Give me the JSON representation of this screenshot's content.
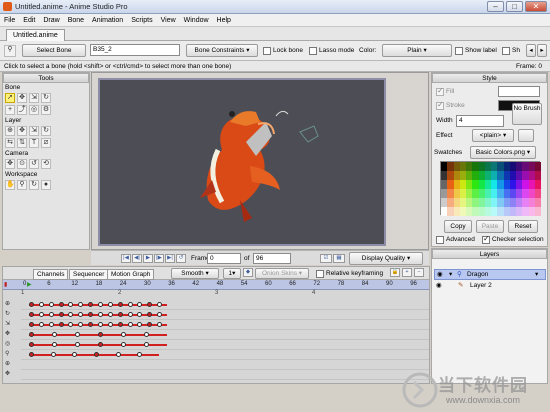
{
  "window": {
    "title": "Untitled.anime - Anime Studio Pro",
    "min": "–",
    "max": "□",
    "close": "✕"
  },
  "menu": [
    "File",
    "Edit",
    "Draw",
    "Bone",
    "Animation",
    "Scripts",
    "View",
    "Window",
    "Help"
  ],
  "doc_tab": "Untitled.anime",
  "tool_options": {
    "select_bone": "Select Bone",
    "bone_name": "B35_2",
    "bone_constraints": "Bone Constraints",
    "lock_bone": "Lock bone",
    "lasso_mode": "Lasso mode",
    "color_label": "Color:",
    "color_value": "Plain",
    "show_label": "Show label",
    "sh_trunc": "Sh"
  },
  "status": {
    "hint": "Click to select a bone (hold <shift> or <ctrl/cmd> to select more than one bone)",
    "frame": "Frame: 0"
  },
  "tools": {
    "title": "Tools",
    "groups": [
      "Bone",
      "Layer",
      "Camera",
      "Workspace"
    ]
  },
  "playback": {
    "frame_label": "Frame",
    "frame_value": "0",
    "of_label": "of",
    "total": "96",
    "display_quality": "Display Quality"
  },
  "timeline": {
    "tabs": [
      "Channels",
      "Sequencer",
      "Motion Graph"
    ],
    "smooth": "Smooth",
    "step": "1",
    "onion_skins": "Onion Skins",
    "relative_keyframing": "Relative keyframing",
    "ruler": [
      "0",
      "6",
      "12",
      "18",
      "24",
      "30",
      "36",
      "42",
      "48",
      "54",
      "60",
      "66",
      "72",
      "78",
      "84",
      "90",
      "96"
    ],
    "markers": [
      "1",
      "2",
      "3",
      "4"
    ]
  },
  "style": {
    "title": "Style",
    "fill": "Fill",
    "stroke": "Stroke",
    "width_label": "Width",
    "width_value": "4",
    "no_brush": "No Brush",
    "effect_label": "Effect",
    "effect_value": "<plain>",
    "swatches_label": "Swatches",
    "swatches_value": "Basic Colors.png",
    "copy": "Copy",
    "paste": "Paste",
    "reset": "Reset",
    "advanced": "Advanced",
    "checker_selection": "Checker selection"
  },
  "layers": {
    "title": "Layers",
    "items": [
      "Dragon",
      "Layer 2"
    ]
  },
  "watermark": {
    "text": "当下软件园",
    "url": "www.downxia.com"
  },
  "colors": {
    "accent": "#e05a1a",
    "ruler": "#bcc6e4",
    "stage": "#4d4d55",
    "keyframe": "#d02020"
  }
}
